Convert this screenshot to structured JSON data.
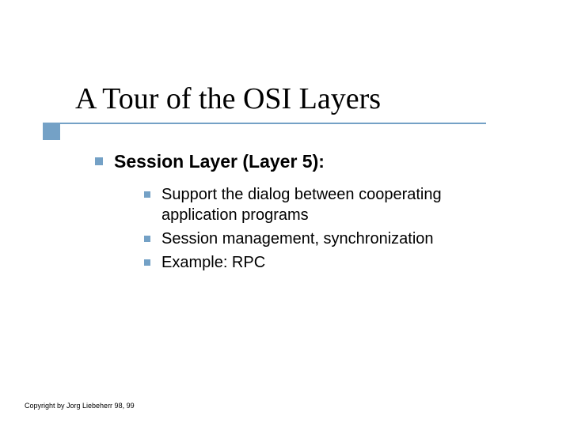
{
  "title": "A Tour of the OSI Layers",
  "level1": {
    "heading": "Session Layer (Layer 5):"
  },
  "level2": {
    "items": [
      "Support the dialog between cooperating application programs",
      "Session management, synchronization",
      "Example: RPC"
    ]
  },
  "footer": "Copyright by Jorg Liebeherr 98, 99"
}
